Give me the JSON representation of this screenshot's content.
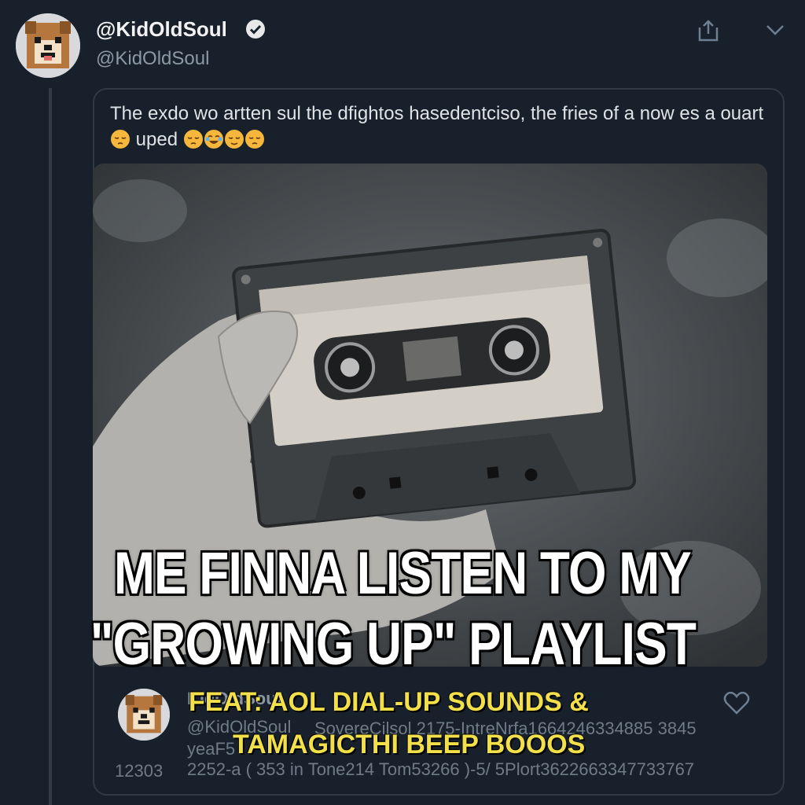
{
  "tweet": {
    "display_name": "@KidOldSoul",
    "handle": "@KidOldSoul",
    "quote_text_a": "The exdo wo artten sul the dfightos hasedentciso, the fries of a now es a ouart",
    "quote_text_b": "uped"
  },
  "meme": {
    "caption_line1": "ME FINNA LISTEN TO MY",
    "caption_line2": "\"GROWING UP\" PLAYLIST",
    "subcaption_line1": "FEAT: AOL DIAL-UP SOUNDS &",
    "subcaption_line2": "TAMAGICTHI BEEP BOOOS"
  },
  "ghost_tweet": {
    "name": "KidOldSoul",
    "handle": "@KidOldSoul",
    "numbers": "SovereCilsol 2175-IntreNrfa1664246334885 3845",
    "year": "yeaF5",
    "count": "12303",
    "footer": "2252-a ( 353 in Tone214 Tom53266 )-5/ 5Plort3622663347733767"
  },
  "icons": {
    "verified": "verified-badge-icon",
    "share": "share-icon",
    "more": "chevron-down-icon",
    "heart": "heart-icon",
    "emoji": "sleepy-face-emoji"
  },
  "colors": {
    "background": "#17202b",
    "caption_text": "#ffffff",
    "subcaption_text": "#f1e04a",
    "muted": "#8b98a5"
  }
}
